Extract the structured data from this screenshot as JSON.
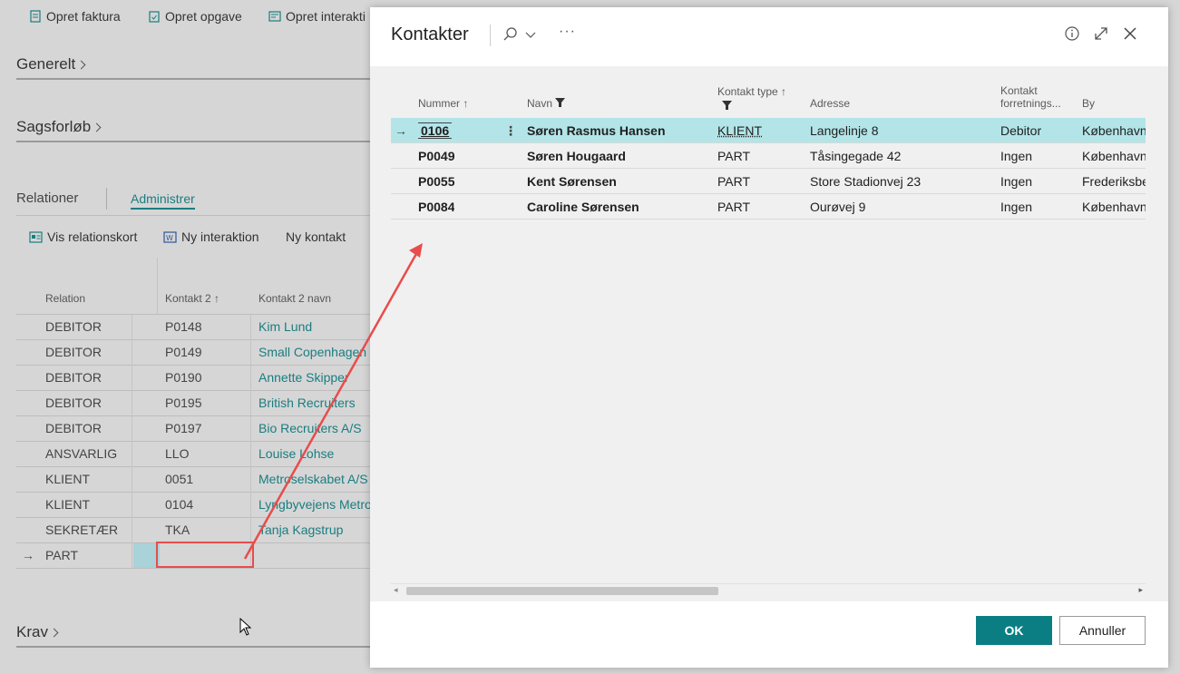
{
  "background_page": {
    "actions": [
      {
        "label": "Opret faktura",
        "icon": "invoice-icon"
      },
      {
        "label": "Opret opgave",
        "icon": "task-icon"
      },
      {
        "label": "Opret interakti",
        "icon": "interaction-icon"
      }
    ],
    "sections": {
      "generelt": "Generelt",
      "sagsforloeb": "Sagsforløb",
      "krav": "Krav"
    },
    "relationer": {
      "title": "Relationer",
      "admin_tab": "Administrer",
      "actions": [
        {
          "label": "Vis relationskort",
          "icon": "card-icon"
        },
        {
          "label": "Ny interaktion",
          "icon": "word-icon"
        },
        {
          "label": "Ny kontakt",
          "icon": ""
        }
      ],
      "columns": {
        "relation": "Relation",
        "kontakt2": "Kontakt 2",
        "kontakt2_navn": "Kontakt 2 navn"
      },
      "rows": [
        {
          "relation": "DEBITOR",
          "kontakt2": "P0148",
          "navn": "Kim Lund"
        },
        {
          "relation": "DEBITOR",
          "kontakt2": "P0149",
          "navn": "Small Copenhagen B"
        },
        {
          "relation": "DEBITOR",
          "kontakt2": "P0190",
          "navn": "Annette Skipper"
        },
        {
          "relation": "DEBITOR",
          "kontakt2": "P0195",
          "navn": "British Recruiters"
        },
        {
          "relation": "DEBITOR",
          "kontakt2": "P0197",
          "navn": "Bio Recruiters A/S"
        },
        {
          "relation": "ANSVARLIG",
          "kontakt2": "LLO",
          "navn": "Louise Lohse"
        },
        {
          "relation": "KLIENT",
          "kontakt2": "0051",
          "navn": "Metroselskabet A/S"
        },
        {
          "relation": "KLIENT",
          "kontakt2": "0104",
          "navn": "Lyngbyvejens Metro"
        },
        {
          "relation": "SEKRETÆR",
          "kontakt2": "TKA",
          "navn": "Tanja Kagstrup"
        },
        {
          "relation": "PART",
          "kontakt2": "",
          "navn": ""
        }
      ]
    }
  },
  "dialog": {
    "title": "Kontakter",
    "columns": {
      "nummer": "Nummer",
      "navn": "Navn",
      "kontakt_type": "Kontakt type",
      "adresse": "Adresse",
      "forretning_line1": "Kontakt",
      "forretning_line2": "forretnings...",
      "by": "By"
    },
    "rows": [
      {
        "nummer": "0106",
        "navn": "Søren Rasmus Hansen",
        "type": "KLIENT",
        "adresse": "Langelinje 8",
        "forretning": "Debitor",
        "by": "København"
      },
      {
        "nummer": "P0049",
        "navn": "Søren Hougaard",
        "type": "PART",
        "adresse": "Tåsingegade 42",
        "forretning": "Ingen",
        "by": "København"
      },
      {
        "nummer": "P0055",
        "navn": "Kent Sørensen",
        "type": "PART",
        "adresse": "Store Stadionvej 23",
        "forretning": "Ingen",
        "by": "Frederiksbe"
      },
      {
        "nummer": "P0084",
        "navn": "Caroline Sørensen",
        "type": "PART",
        "adresse": "Ourøvej 9",
        "forretning": "Ingen",
        "by": "København"
      }
    ],
    "buttons": {
      "ok": "OK",
      "cancel": "Annuller"
    }
  },
  "colors": {
    "accent": "#0a7e83",
    "selected_row": "#b3e5e8",
    "annotation_red": "#e84c4c"
  }
}
